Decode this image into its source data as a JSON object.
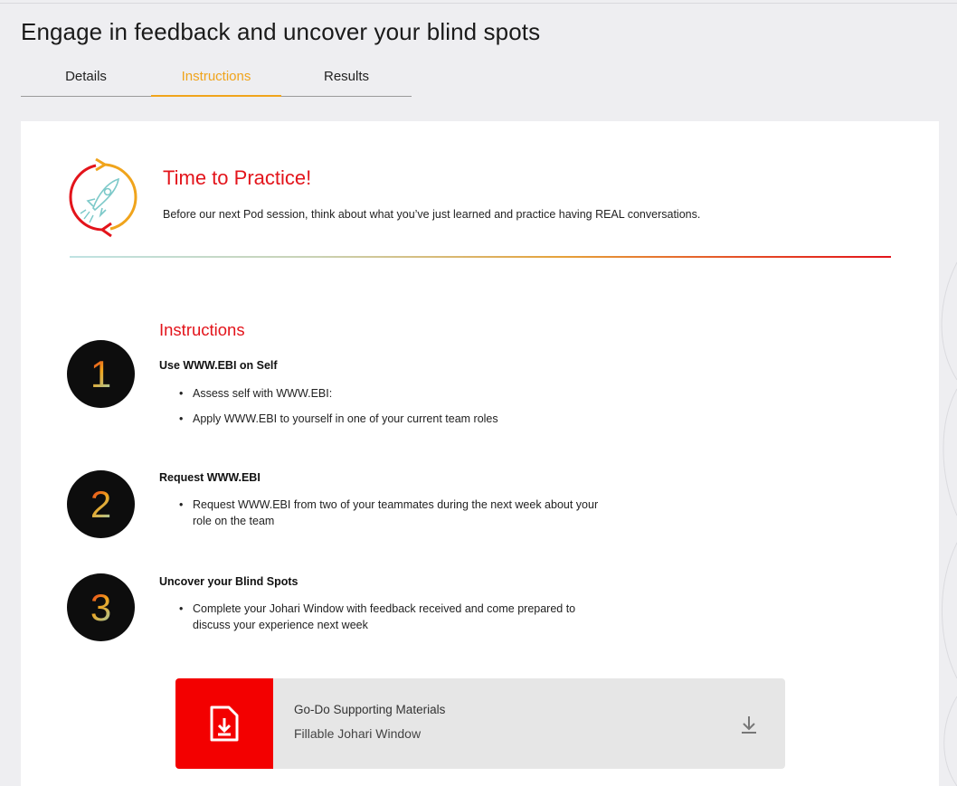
{
  "page": {
    "title": "Engage in feedback and uncover your blind spots"
  },
  "tabs": [
    {
      "label": "Details",
      "active": false
    },
    {
      "label": "Instructions",
      "active": true
    },
    {
      "label": "Results",
      "active": false
    }
  ],
  "practice": {
    "title": "Time to Practice!",
    "description": "Before our next Pod session, think about what you’ve just learned and practice having REAL conversations.",
    "icon": "rocket-cycle-icon"
  },
  "instructions": {
    "heading": "Instructions",
    "steps": [
      {
        "number": "1",
        "title": "Use WWW.EBI on Self",
        "bullets": [
          "Assess self with WWW.EBI:",
          "Apply WWW.EBI to yourself in one of your current team roles"
        ]
      },
      {
        "number": "2",
        "title": "Request WWW.EBI",
        "bullets": [
          "Request WWW.EBI from two of your teammates during the next week about your role on the team"
        ]
      },
      {
        "number": "3",
        "title": "Uncover your Blind Spots",
        "bullets": [
          "Complete your Johari Window with feedback received and come prepared to discuss your experience next week"
        ]
      }
    ]
  },
  "materials": {
    "label": "Go-Do Supporting Materials",
    "file_name": "Fillable Johari Window",
    "file_icon": "document-download-icon",
    "action_icon": "download-icon"
  },
  "colors": {
    "accent_orange": "#f0a41c",
    "accent_red": "#e3141b",
    "materials_red": "#f30000"
  }
}
